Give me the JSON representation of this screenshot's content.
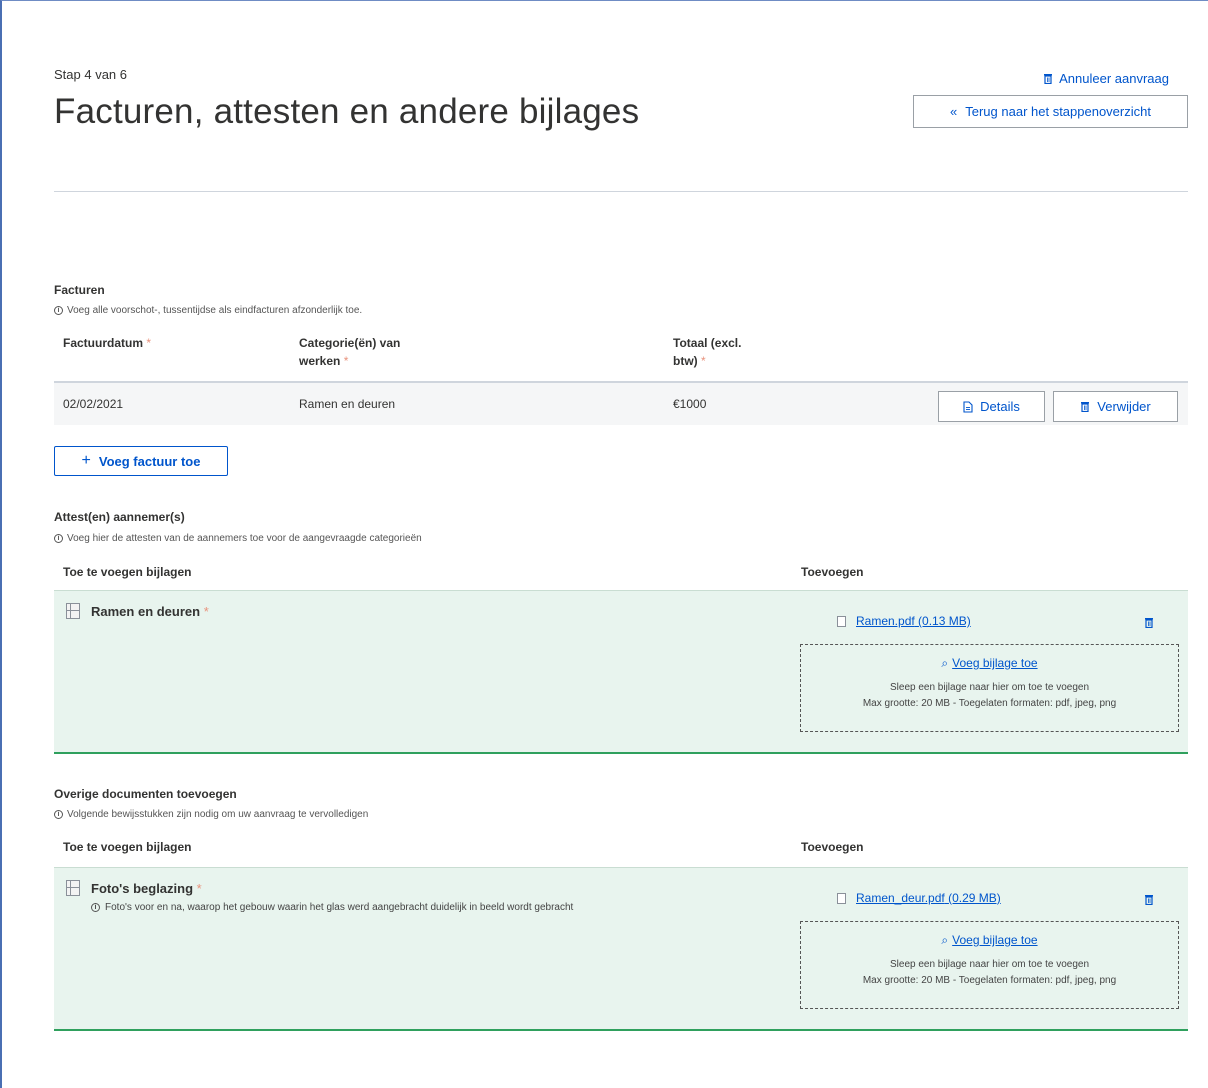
{
  "header": {
    "step": "Stap 4 van 6",
    "title": "Facturen, attesten en andere bijlages",
    "cancel_label": "Annuleer aanvraag",
    "back_label": "Terug naar het stappenoverzicht"
  },
  "invoices": {
    "title": "Facturen",
    "hint": "Voeg alle voorschot-, tussentijdse als eindfacturen afzonderlijk toe.",
    "columns": {
      "date": "Factuurdatum",
      "category_line1": "Categorie(ën) van",
      "category_line2": "werken",
      "total_line1": "Totaal (excl.",
      "total_line2": "btw)"
    },
    "rows": [
      {
        "date": "02/02/2021",
        "category": "Ramen en deuren",
        "total": "€1000"
      }
    ],
    "details_label": "Details",
    "delete_label": "Verwijder",
    "add_label": "Voeg factuur toe"
  },
  "contractor": {
    "title": "Attest(en) aannemer(s)",
    "hint": "Voeg hier de attesten van de aannemers toe voor de aangevraagde categorieën",
    "col_attachments": "Toe te voegen bijlagen",
    "col_add": "Toevoegen",
    "item_name": "Ramen en deuren",
    "file_name": "Ramen.pdf",
    "file_size": "(0.13 MB)"
  },
  "other_docs": {
    "title": "Overige documenten toevoegen",
    "hint": "Volgende bewijsstukken zijn nodig om uw aanvraag te vervolledigen",
    "col_attachments": "Toe te voegen bijlagen",
    "col_add": "Toevoegen",
    "item_name": "Foto's beglazing",
    "item_desc": "Foto's voor en na, waarop het gebouw waarin het glas werd aangebracht duidelijk in beeld wordt gebracht",
    "file_name": "Ramen_deur.pdf",
    "file_size": "(0.29 MB)"
  },
  "dropzone": {
    "link": "Voeg bijlage toe",
    "line1": "Sleep een bijlage naar hier om toe te voegen",
    "line2": "Max grootte: 20 MB - Toegelaten formaten: pdf, jpeg, png"
  },
  "required_marker": "*",
  "colors": {
    "link": "#0055cc",
    "success_bg": "#e8f4ee",
    "success_border": "#2fa05d",
    "required": "#e8927c"
  }
}
